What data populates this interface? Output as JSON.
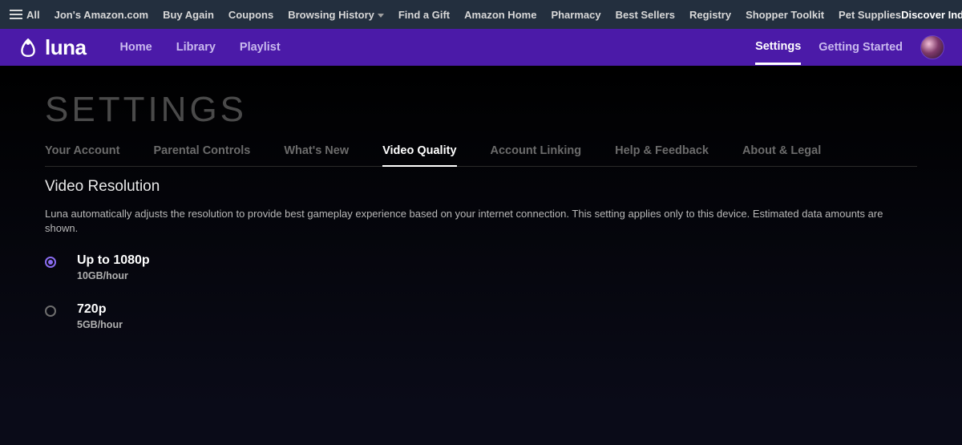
{
  "top_bar": {
    "all_label": "All",
    "links": [
      "Jon's Amazon.com",
      "Buy Again",
      "Coupons",
      "Browsing History",
      "Find a Gift",
      "Amazon Home",
      "Pharmacy",
      "Best Sellers",
      "Registry",
      "Shopper Toolkit",
      "Pet Supplies"
    ],
    "discover": "Discover Indie Beauty"
  },
  "luna_bar": {
    "logo_text": "luna",
    "nav": [
      "Home",
      "Library",
      "Playlist"
    ],
    "right_links": [
      {
        "label": "Settings",
        "active": true
      },
      {
        "label": "Getting Started",
        "active": false
      }
    ]
  },
  "page": {
    "title": "SETTINGS",
    "tabs": [
      {
        "label": "Your Account",
        "active": false
      },
      {
        "label": "Parental Controls",
        "active": false
      },
      {
        "label": "What's New",
        "active": false
      },
      {
        "label": "Video Quality",
        "active": true
      },
      {
        "label": "Account Linking",
        "active": false
      },
      {
        "label": "Help & Feedback",
        "active": false
      },
      {
        "label": "About & Legal",
        "active": false
      }
    ],
    "section_title": "Video Resolution",
    "section_desc": "Luna automatically adjusts the resolution to provide best gameplay experience based on your internet connection. This setting applies only to this device. Estimated data amounts are shown.",
    "options": [
      {
        "title": "Up to 1080p",
        "sub": "10GB/hour",
        "selected": true
      },
      {
        "title": "720p",
        "sub": "5GB/hour",
        "selected": false
      }
    ]
  }
}
